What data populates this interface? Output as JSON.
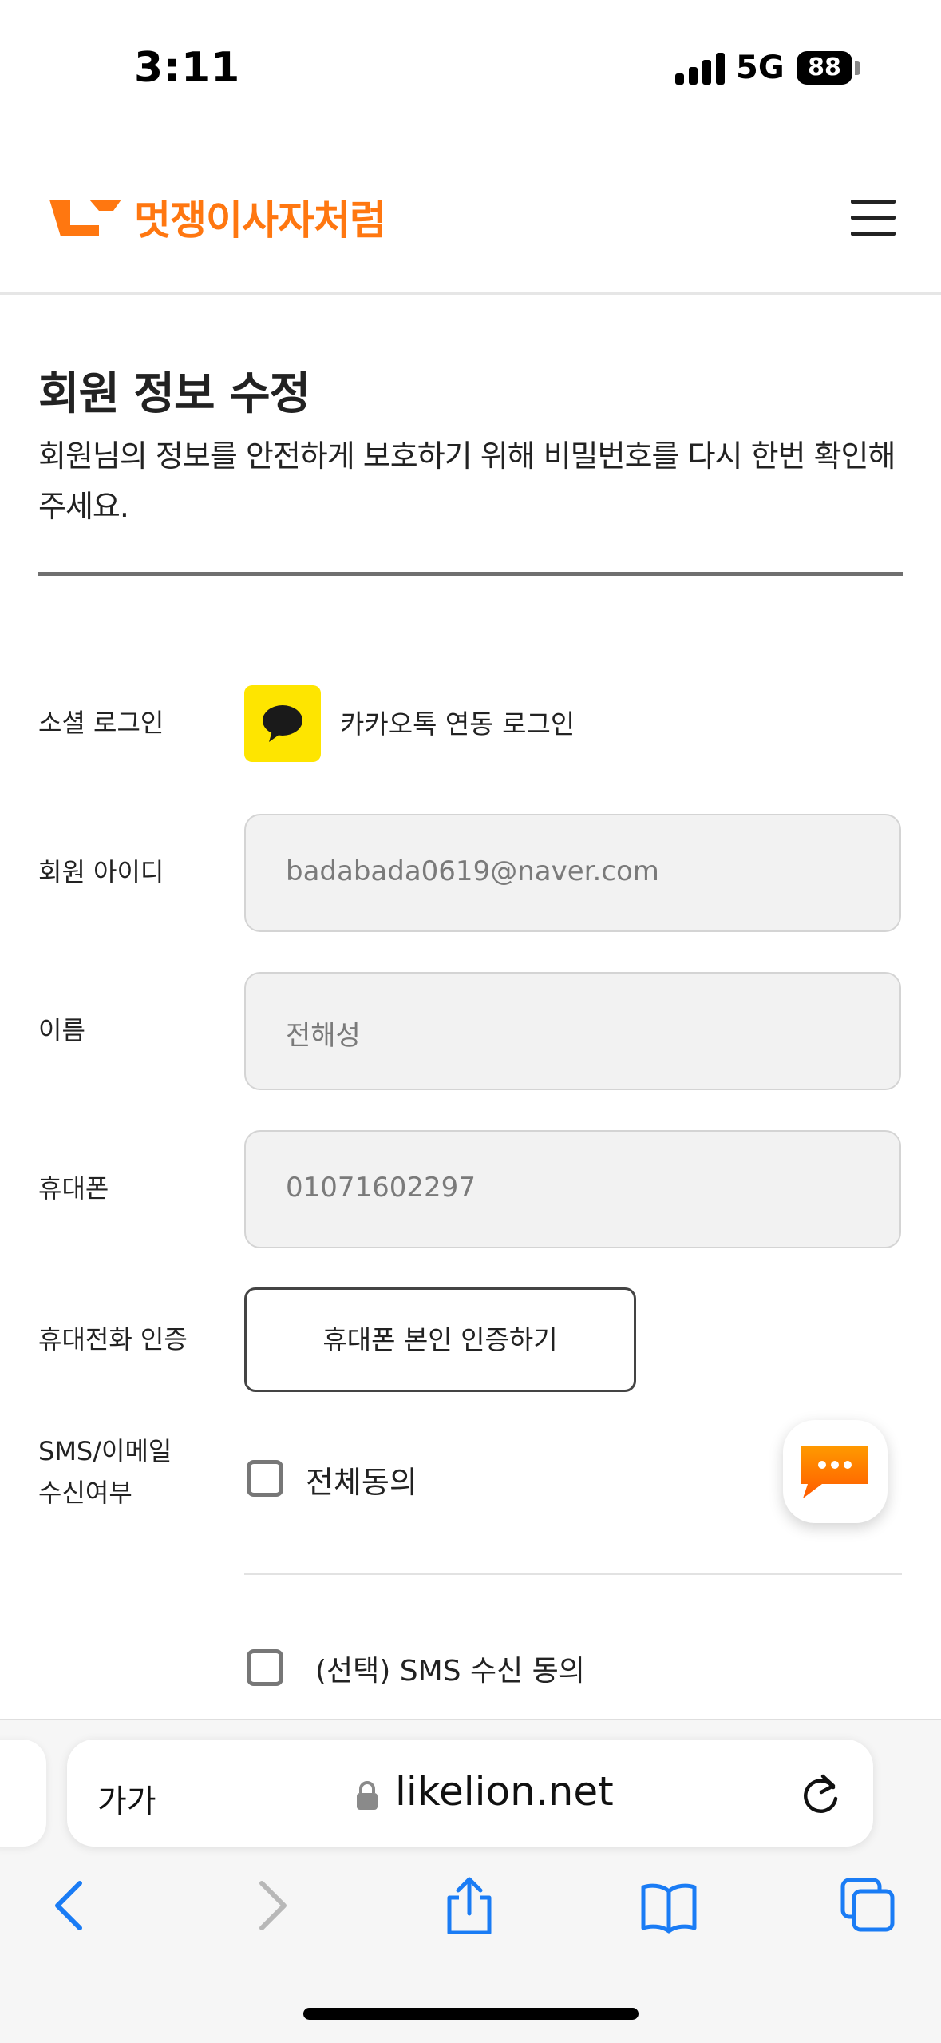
{
  "status_bar": {
    "time": "3:11",
    "network": "5G",
    "battery": "88"
  },
  "header": {
    "logo_text": "멋쟁이사자처럼",
    "brand_color": "#ff7710",
    "menu_icon": "hamburger-menu-icon"
  },
  "page": {
    "title": "회원 정보 수정",
    "description": "회원님의 정보를 안전하게 보호하기 위해 비밀번호를 다시 한번 확인해주세요."
  },
  "form": {
    "social_login": {
      "label": "소셜 로그인",
      "icon": "kakao-talk-icon",
      "value": "카카오톡 연동 로그인"
    },
    "member_id": {
      "label": "회원 아이디",
      "value": "badabada0619@naver.com"
    },
    "name": {
      "label": "이름",
      "value": "전해성"
    },
    "phone": {
      "label": "휴대폰",
      "value": "01071602297"
    },
    "phone_verification": {
      "label": "휴대전화 인증",
      "button": "휴대폰 본인 인증하기"
    },
    "consent": {
      "label_line1": "SMS/이메일",
      "label_line2": "수신여부",
      "all_agree": "전체동의",
      "sms_agree": "(선택) SMS 수신 동의"
    }
  },
  "chat_button": {
    "icon": "chat-bubble-icon",
    "color": "#ff7a00"
  },
  "browser": {
    "text_size_label": "가가",
    "url": "likelion.net",
    "icons": [
      "back-icon",
      "forward-icon",
      "share-icon",
      "bookmarks-icon",
      "tabs-icon"
    ],
    "accent_color": "#1a7cf5"
  }
}
